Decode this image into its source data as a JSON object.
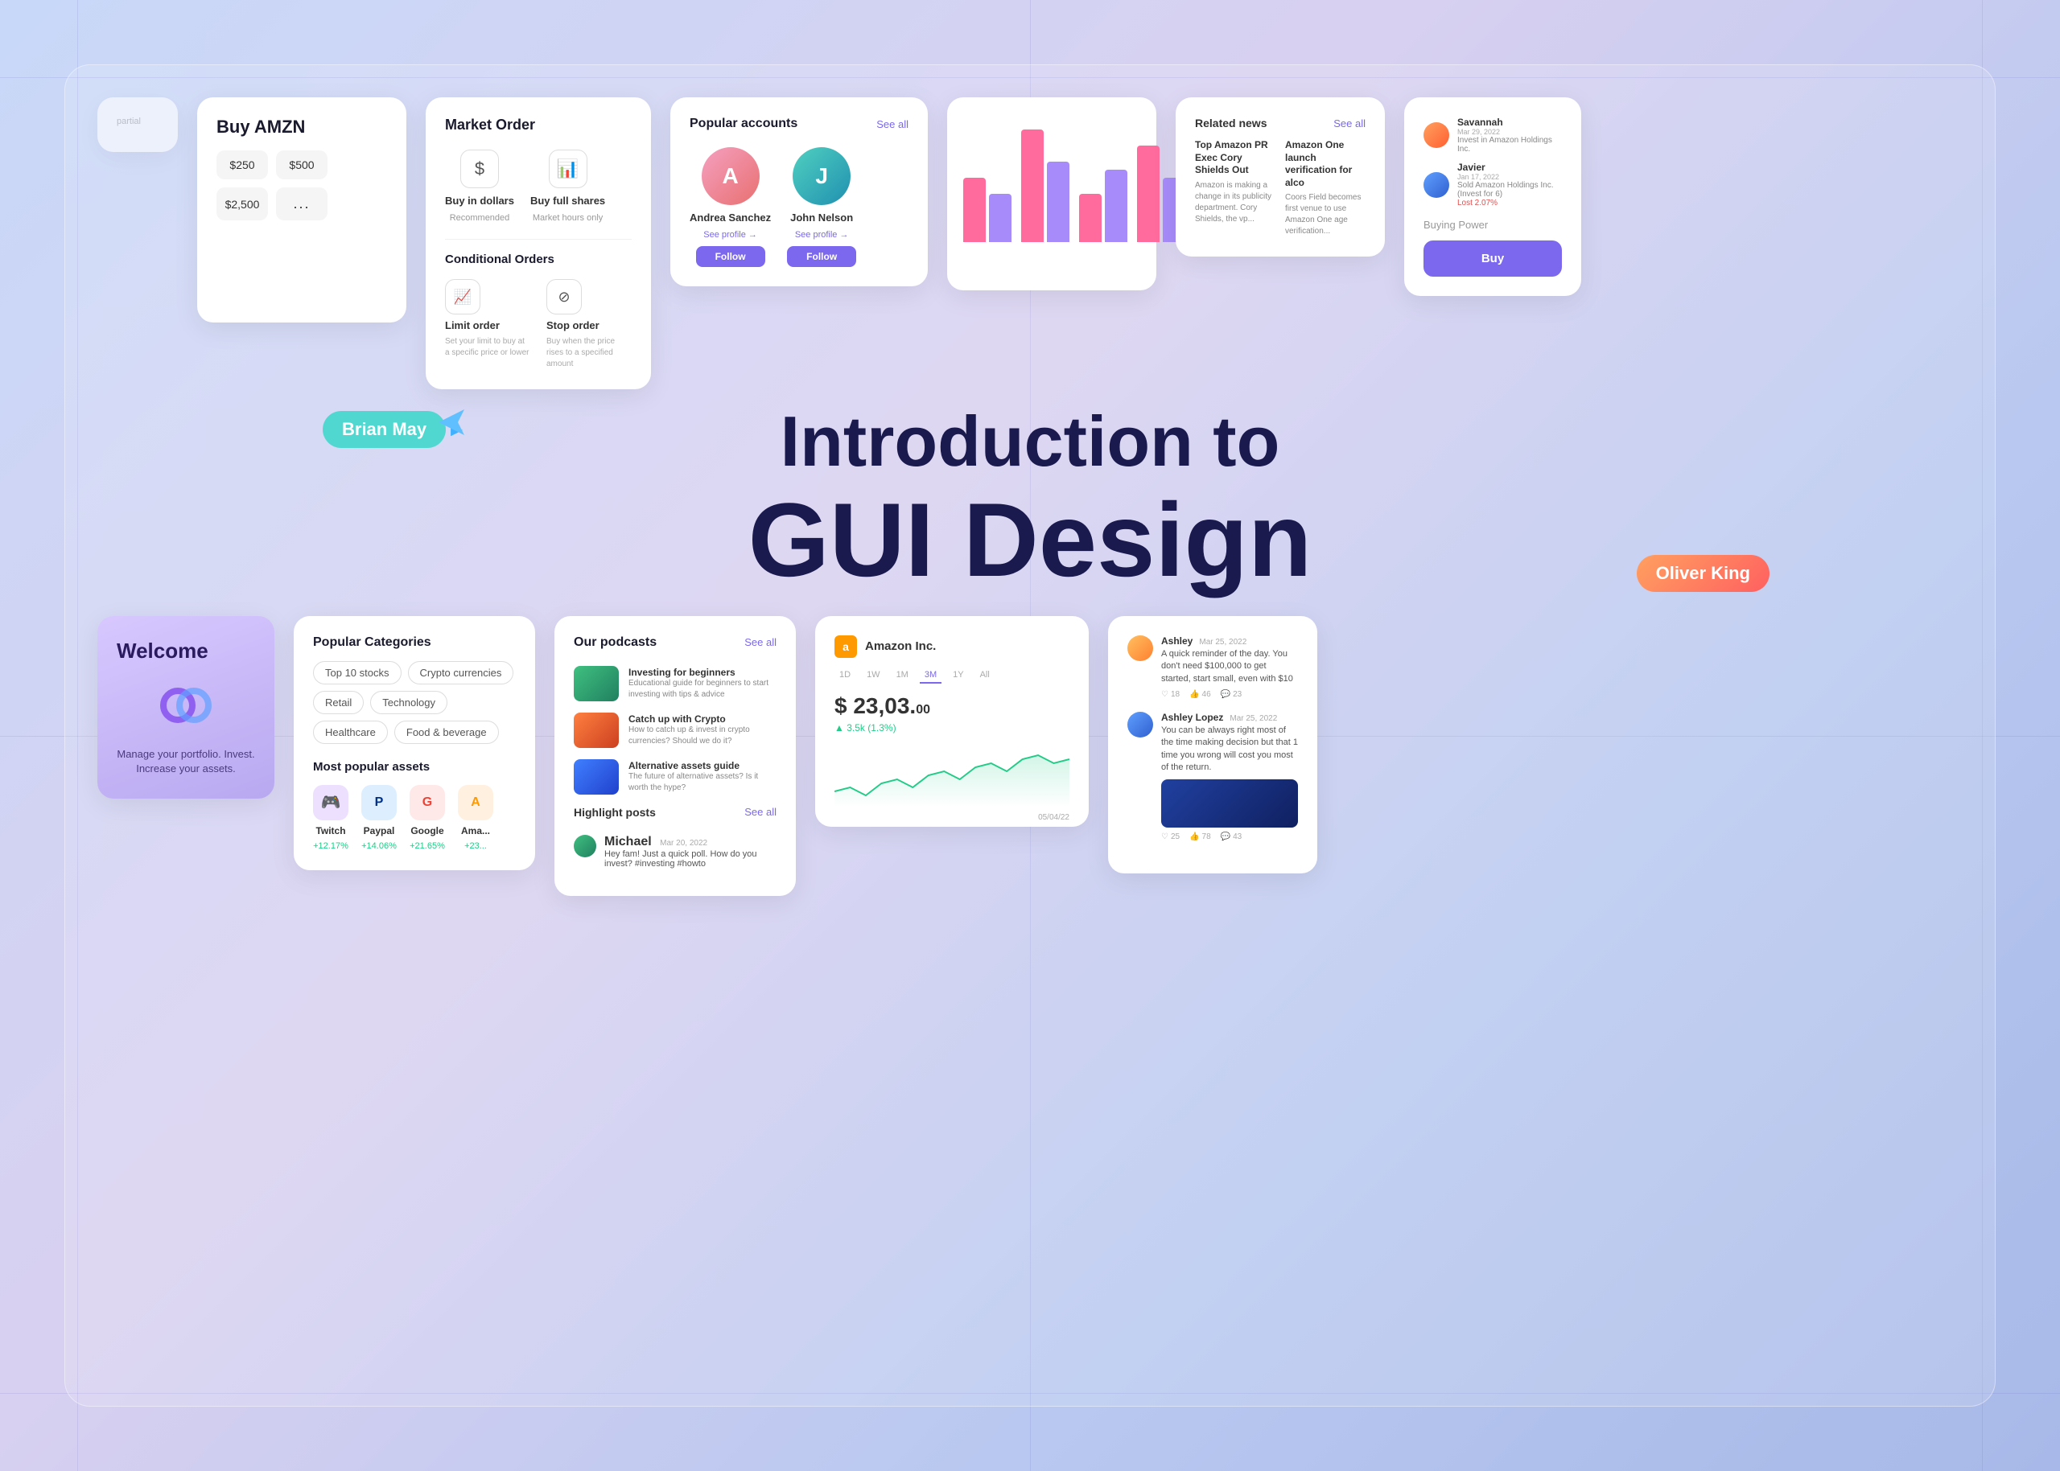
{
  "page": {
    "background": "gradient",
    "title": "Introduction to GUI Design"
  },
  "hero": {
    "line1": "Introduction to",
    "line2": "GUI Design",
    "brian_tag": "Brian May",
    "oliver_tag": "Oliver King"
  },
  "buy_amzn": {
    "title": "Buy AMZN",
    "amounts": [
      "$250",
      "$500",
      "$2,500",
      "..."
    ],
    "preset1": "$250",
    "preset2": "$500",
    "preset3": "$2,500",
    "dots": "..."
  },
  "market_order": {
    "title": "Market Order",
    "buy_dollars_label": "Buy in dollars",
    "buy_dollars_sub": "Recommended",
    "buy_shares_label": "Buy full shares",
    "buy_shares_sub": "Market hours only",
    "conditional_title": "Conditional Orders",
    "limit_order_label": "Limit order",
    "limit_order_sub": "Set your limit to buy at a specific price or lower",
    "stop_order_label": "Stop order",
    "stop_order_sub": "Buy when the price rises to a specified amount"
  },
  "popular_accounts": {
    "title": "Popular accounts",
    "see_all": "See all",
    "accounts": [
      {
        "name": "Andrea Sanchez",
        "link": "See profile →",
        "follow": "Follow"
      },
      {
        "name": "John Nelson",
        "link": "See profile →",
        "follow": "Follow"
      }
    ]
  },
  "chart": {
    "bars": [
      {
        "pink": 80,
        "purple": 60
      },
      {
        "pink": 140,
        "purple": 100
      },
      {
        "pink": 60,
        "purple": 90
      },
      {
        "pink": 120,
        "purple": 80
      }
    ]
  },
  "buying_power": {
    "label": "Buying Power",
    "buy_btn": "Buy",
    "users": [
      {
        "name": "Savannah",
        "date": "Mar 29, 2022",
        "action": "Invest in Amazon Holdings Inc."
      },
      {
        "name": "Javier",
        "date": "Jan 17, 2022",
        "action": "Sold Amazon Holdings Inc. (Invest for 6)",
        "change": "Lost 2.07%"
      }
    ]
  },
  "welcome": {
    "title": "Welcome",
    "text": "Manage your portfolio. Invest. Increase your assets."
  },
  "categories": {
    "title": "Popular Categories",
    "tags": [
      "Top 10 stocks",
      "Crypto currencies",
      "Retail",
      "Technology",
      "Healthcare",
      "Food & beverage"
    ],
    "assets_title": "Most popular assets",
    "assets": [
      {
        "name": "Twitch",
        "change": "+12.17%",
        "icon": "🎮"
      },
      {
        "name": "Paypal",
        "change": "+14.06%",
        "icon": "P"
      },
      {
        "name": "Google",
        "change": "+21.65%",
        "icon": "G"
      },
      {
        "name": "Ama...",
        "change": "+23...",
        "icon": "A"
      }
    ]
  },
  "podcasts": {
    "title": "Our podcasts",
    "see_all": "See all",
    "items": [
      {
        "title": "Investing for beginners",
        "sub": "Educational guide for beginners to start investing with tips & advice"
      },
      {
        "title": "Catch up with Crypto",
        "sub": "How to catch up & invest in crypto currencies? Should we do it?"
      },
      {
        "title": "Alternative assets guide",
        "sub": "The future of alternative assets? Is it worth the hype?"
      }
    ],
    "highlight_title": "Highlight posts",
    "highlight_see_all": "See all",
    "highlight_items": [
      {
        "name": "Michael",
        "date": "Mar 20, 2022",
        "text": "Hey fam! Just a quick poll. How do you invest? #investing #howto"
      }
    ]
  },
  "amazon_stock": {
    "company": "Amazon Inc.",
    "price": "$ 23,03.",
    "cents": "00",
    "change": "▲ 3.5k (1.3%)",
    "date": "05/04/22",
    "time_tabs": [
      "1D",
      "1W",
      "1M",
      "3M",
      "1Y",
      "All"
    ]
  },
  "social": {
    "items": [
      {
        "name": "Ashley",
        "date": "Mar 25, 2022",
        "text": "A quick reminder of the day. You don't need $100,000 to get started, start small, even with $10",
        "likes": "18",
        "hearts": "46",
        "comments": "23"
      },
      {
        "name": "Ashley Lopez",
        "date": "Mar 25, 2022",
        "text": "You can be always right most of the time making decision but that 1 time you wrong will cost you most of the return.",
        "likes": "25",
        "hearts": "78",
        "comments": "43"
      }
    ]
  },
  "related_news": {
    "title": "Related news",
    "see_all": "See all",
    "items": [
      {
        "title": "Top Amazon PR Exec Cory Shields Out",
        "sub": "Amazon is making a change in its publicity department. Cory Shields, the vp..."
      },
      {
        "title": "Amazon One launch verification for alco",
        "sub": "Coors Field becomes first venue to use Amazon One age verification..."
      }
    ]
  }
}
